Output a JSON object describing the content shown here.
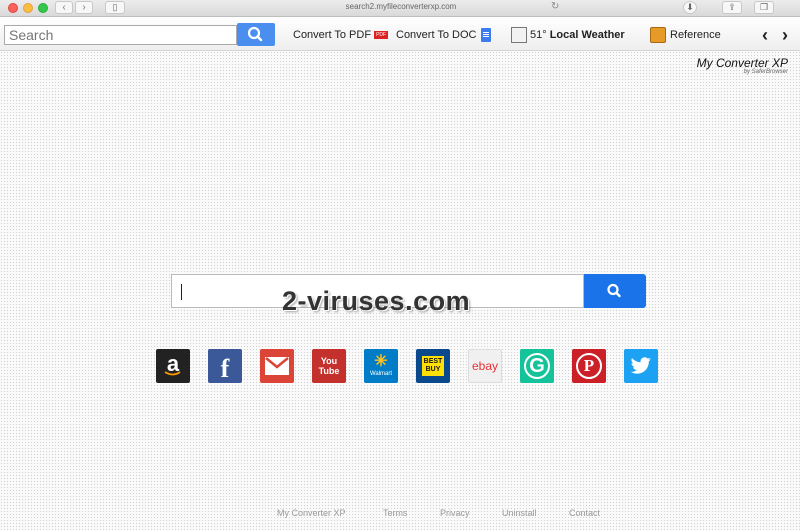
{
  "browser": {
    "url": "search2.myfileconverterxp.com",
    "back_glyph": "‹",
    "forward_glyph": "›",
    "icons": [
      "sidebar-icon",
      "reload-icon",
      "download-icon",
      "share-icon",
      "tabs-icon"
    ]
  },
  "toolbar": {
    "search_placeholder": "Search",
    "items": {
      "convert_pdf": "Convert To PDF",
      "pdf_badge": "PDF",
      "convert_doc": "Convert To DOC",
      "temp": "51°",
      "weather": "Local Weather",
      "reference": "Reference"
    },
    "arrows": {
      "left": "‹",
      "right": "›"
    }
  },
  "brand": {
    "name": "My Converter XP",
    "sub": "by SaferBrowser"
  },
  "main": {
    "watermark": "2-viruses.com"
  },
  "quicklinks": [
    {
      "name": "amazon",
      "label": "a",
      "color": "#222222"
    },
    {
      "name": "facebook",
      "label": "f",
      "color": "#3b5998"
    },
    {
      "name": "gmail",
      "label": "M",
      "color": "#db4437"
    },
    {
      "name": "youtube",
      "label": "You Tube",
      "color": "#c4302b"
    },
    {
      "name": "walmart",
      "label": "Walmart",
      "color": "#007dc6"
    },
    {
      "name": "bestbuy",
      "label": "BEST BUY",
      "color": "#0a4a8c"
    },
    {
      "name": "ebay",
      "label": "ebay",
      "color": "#f0f0f0"
    },
    {
      "name": "grammarly",
      "label": "G",
      "color": "#15c39a"
    },
    {
      "name": "pinterest",
      "label": "P",
      "color": "#cb2027"
    },
    {
      "name": "twitter",
      "label": "t",
      "color": "#1da1f2"
    }
  ],
  "footer": {
    "links": [
      "My Converter XP",
      "Terms",
      "Privacy",
      "Uninstall",
      "Contact"
    ]
  }
}
